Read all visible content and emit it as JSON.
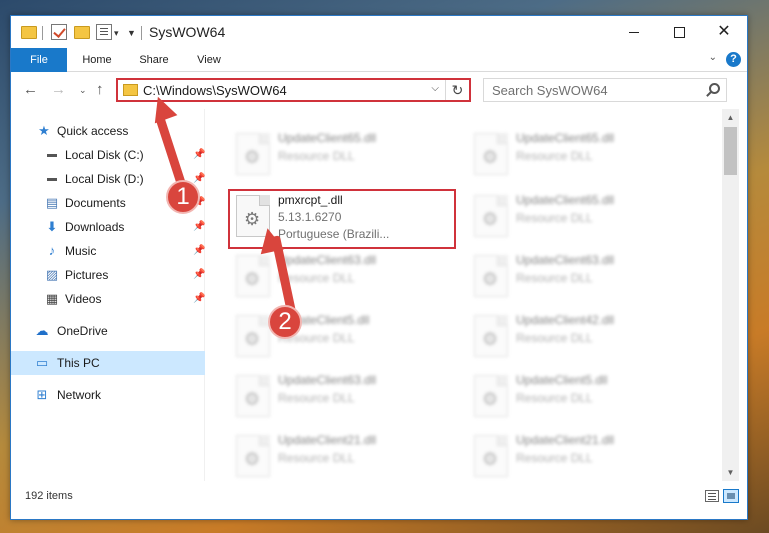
{
  "window": {
    "title": "SysWOW64",
    "minimize": "",
    "maximize": "",
    "close": "✕"
  },
  "ribbon": {
    "tabs": [
      "File",
      "Home",
      "Share",
      "View"
    ],
    "expand_icon": "chevron-down-icon",
    "help_label": "?"
  },
  "navigation": {
    "back": "←",
    "forward": "→",
    "recent": "⌄",
    "up": "↑",
    "address": "C:\\Windows\\SysWOW64",
    "refresh": "↻",
    "search_placeholder": "Search SysWOW64"
  },
  "sidebar": {
    "items": [
      {
        "label": "Quick access",
        "icon": "star-icon",
        "pinned": false
      },
      {
        "label": "Local Disk (C:)",
        "icon": "disk-icon",
        "pinned": true
      },
      {
        "label": "Local Disk (D:)",
        "icon": "disk-icon",
        "pinned": true
      },
      {
        "label": "Documents",
        "icon": "documents-icon",
        "pinned": true
      },
      {
        "label": "Downloads",
        "icon": "download-icon",
        "pinned": true
      },
      {
        "label": "Music",
        "icon": "music-icon",
        "pinned": true
      },
      {
        "label": "Pictures",
        "icon": "pictures-icon",
        "pinned": true
      },
      {
        "label": "Videos",
        "icon": "videos-icon",
        "pinned": true
      },
      {
        "label": "OneDrive",
        "icon": "cloud-icon",
        "pinned": false
      },
      {
        "label": "This PC",
        "icon": "computer-icon",
        "pinned": false,
        "selected": true
      },
      {
        "label": "Network",
        "icon": "network-icon",
        "pinned": false
      }
    ]
  },
  "files": {
    "left_column": [
      {
        "name": "UpdateClient65.dll",
        "type": "Resource DLL",
        "blurred": true
      },
      {
        "name": "pmxrcpt_.dll",
        "version": "5.13.1.6270",
        "language": "Portuguese (Brazili...",
        "blurred": false,
        "highlighted": true
      },
      {
        "name": "UpdateClient63.dll",
        "type": "Resource DLL",
        "blurred": true
      },
      {
        "name": "UpdateClient5.dll",
        "type": "Resource DLL",
        "blurred": true
      },
      {
        "name": "UpdateClient63.dll",
        "type": "Resource DLL",
        "blurred": true
      },
      {
        "name": "UpdateClient21.dll",
        "type": "Resource DLL",
        "blurred": true
      }
    ],
    "right_column": [
      {
        "name": "UpdateClient65.dll",
        "type": "Resource DLL",
        "blurred": true
      },
      {
        "name": "UpdateClient65.dll",
        "type": "Resource DLL",
        "blurred": true
      },
      {
        "name": "UpdateClient63.dll",
        "type": "Resource DLL",
        "blurred": true
      },
      {
        "name": "UpdateClient42.dll",
        "type": "Resource DLL",
        "blurred": true
      },
      {
        "name": "UpdateClient5.dll",
        "type": "Resource DLL",
        "blurred": true
      },
      {
        "name": "UpdateClient21.dll",
        "type": "Resource DLL",
        "blurred": true
      }
    ]
  },
  "status": {
    "item_count": "192 items"
  },
  "annotations": {
    "step1": "1",
    "step2": "2",
    "color": "#d9453d"
  }
}
